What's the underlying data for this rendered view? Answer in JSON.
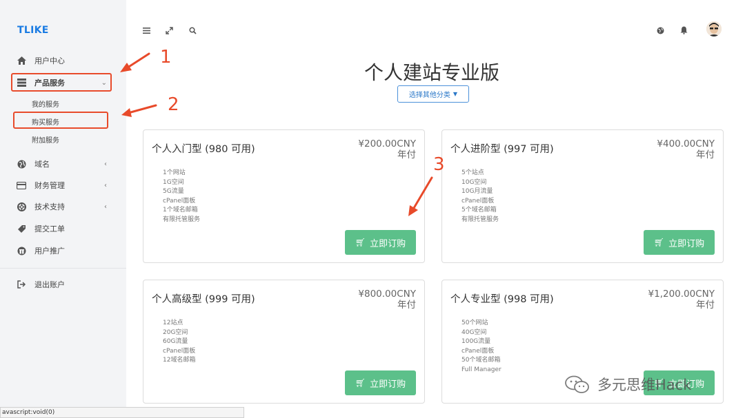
{
  "brand": "TLIKE",
  "sidebar": {
    "items": [
      {
        "label": "用户中心",
        "icon": "home-icon"
      },
      {
        "label": "产品服务",
        "icon": "server-icon",
        "expanded": true
      },
      {
        "label": "域名",
        "icon": "globe-icon"
      },
      {
        "label": "财务管理",
        "icon": "credit-card-icon"
      },
      {
        "label": "技术支持",
        "icon": "lifebuoy-icon"
      },
      {
        "label": "提交工单",
        "icon": "ticket-icon"
      },
      {
        "label": "用户推广",
        "icon": "gift-icon"
      },
      {
        "label": "退出账户",
        "icon": "sign-out-icon"
      }
    ],
    "subitems": [
      "我的服务",
      "购买服务",
      "附加服务"
    ]
  },
  "main": {
    "title": "个人建站专业版",
    "category_button": "选择其他分类",
    "buy_label": "立即订购",
    "cards": [
      {
        "name": "个人入门型 (980 可用)",
        "price": "¥200.00CNY",
        "period": "年付",
        "features": [
          "1个网站",
          "1G空间",
          "5G流量",
          "cPanel面板",
          "1个域名邮箱",
          "有限托管服务"
        ]
      },
      {
        "name": "个人进阶型 (997 可用)",
        "price": "¥400.00CNY",
        "period": "年付",
        "features": [
          "5个站点",
          "10G空间",
          "10G月流量",
          "cPanel面板",
          "5个域名邮箱",
          "有限托管服务"
        ]
      },
      {
        "name": "个人高级型 (999 可用)",
        "price": "¥800.00CNY",
        "period": "年付",
        "features": [
          "12站点",
          "20G空间",
          "60G流量",
          "cPanel面板",
          "12域名邮箱"
        ]
      },
      {
        "name": "个人专业型 (998 可用)",
        "price": "¥1,200.00CNY",
        "period": "年付",
        "features": [
          "50个网站",
          "40G空间",
          "100G流量",
          "cPanel面板",
          "50个域名邮箱",
          "Full Manager"
        ]
      }
    ]
  },
  "annotations": [
    "1",
    "2",
    "3"
  ],
  "annotation_color": "#e84a2a",
  "accent_color": "#5cc08a",
  "status_text": "avascript:void(0)",
  "watermark": "多元思维Hack"
}
